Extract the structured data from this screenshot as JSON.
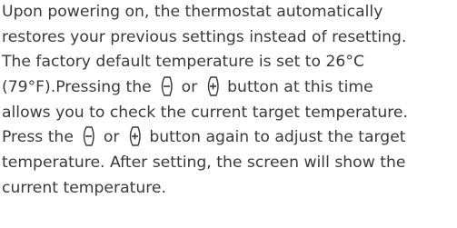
{
  "paragraph": {
    "line1": "Upon powering on, the thermostat automatically",
    "line2": "restores your previous settings instead of resetting.",
    "line3": "The factory default temperature is set to 26°C",
    "line4_a": "(79°F).Pressing the ",
    "line4_b": " or ",
    "line4_c": " button at this time",
    "line5": "allows you to check the current target temperature.",
    "line6_a": "Press the ",
    "line6_b": " or ",
    "line6_c": " button again to adjust the target",
    "line7": "temperature. After setting, the screen will show the",
    "line8": "current temperature."
  },
  "icons": {
    "minus": "minus-button-icon",
    "plus": "plus-button-icon"
  },
  "colors": {
    "text": "#3a3a3a",
    "background": "#ffffff"
  }
}
